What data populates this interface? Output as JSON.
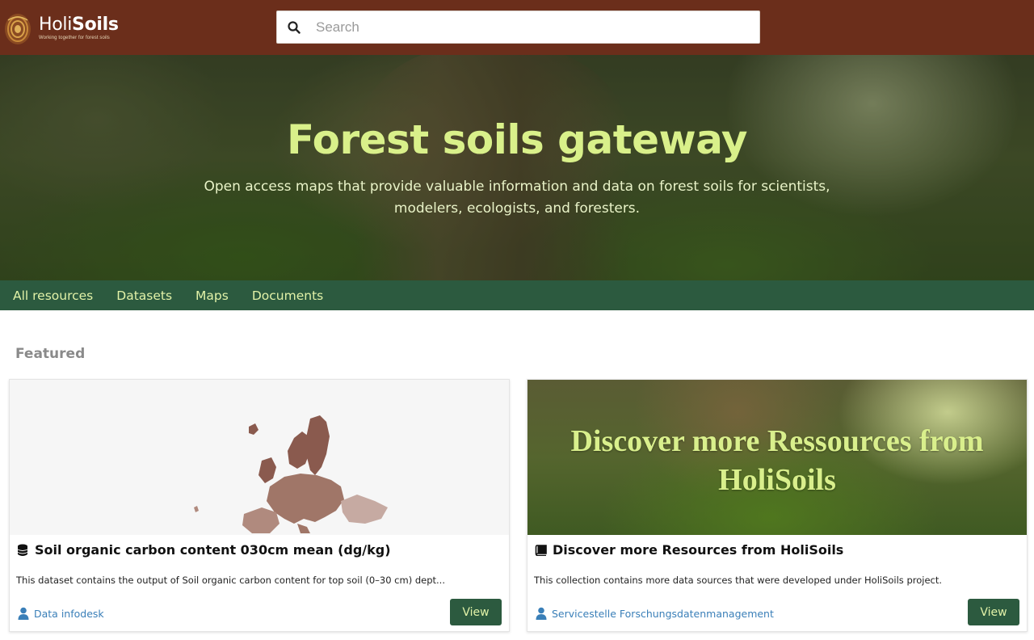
{
  "header": {
    "logo_name_light": "Holi",
    "logo_name_bold": "Soils",
    "logo_tagline": "Working together for forest soils",
    "search_placeholder": "Search"
  },
  "hero": {
    "title": "Forest soils gateway",
    "subtitle": "Open access maps that provide valuable information and data on forest soils for scientists, modelers, ecologists, and foresters."
  },
  "nav": {
    "items": [
      "All resources",
      "Datasets",
      "Maps",
      "Documents"
    ]
  },
  "featured": {
    "label": "Featured",
    "cards": [
      {
        "title": "Soil organic carbon content 030cm mean (dg/kg)",
        "icon": "database-icon",
        "description": "This dataset contains the output of Soil organic carbon content for top soil (0–30 cm) dept...",
        "owner": "Data infodesk",
        "button": "View"
      },
      {
        "title": "Discover more Resources from HoliSoils",
        "icon": "book-icon",
        "image_text": "Discover more Ressources from HoliSoils",
        "description": "This collection contains more data sources that were developed under HoliSoils project.",
        "owner": "Servicestelle Forschungsdatenmanagement",
        "button": "View"
      }
    ]
  },
  "colors": {
    "header_bg": "#6b2e1b",
    "nav_bg": "#2c5a3f",
    "accent_text": "#d9f08a",
    "link": "#3a7fb8"
  }
}
